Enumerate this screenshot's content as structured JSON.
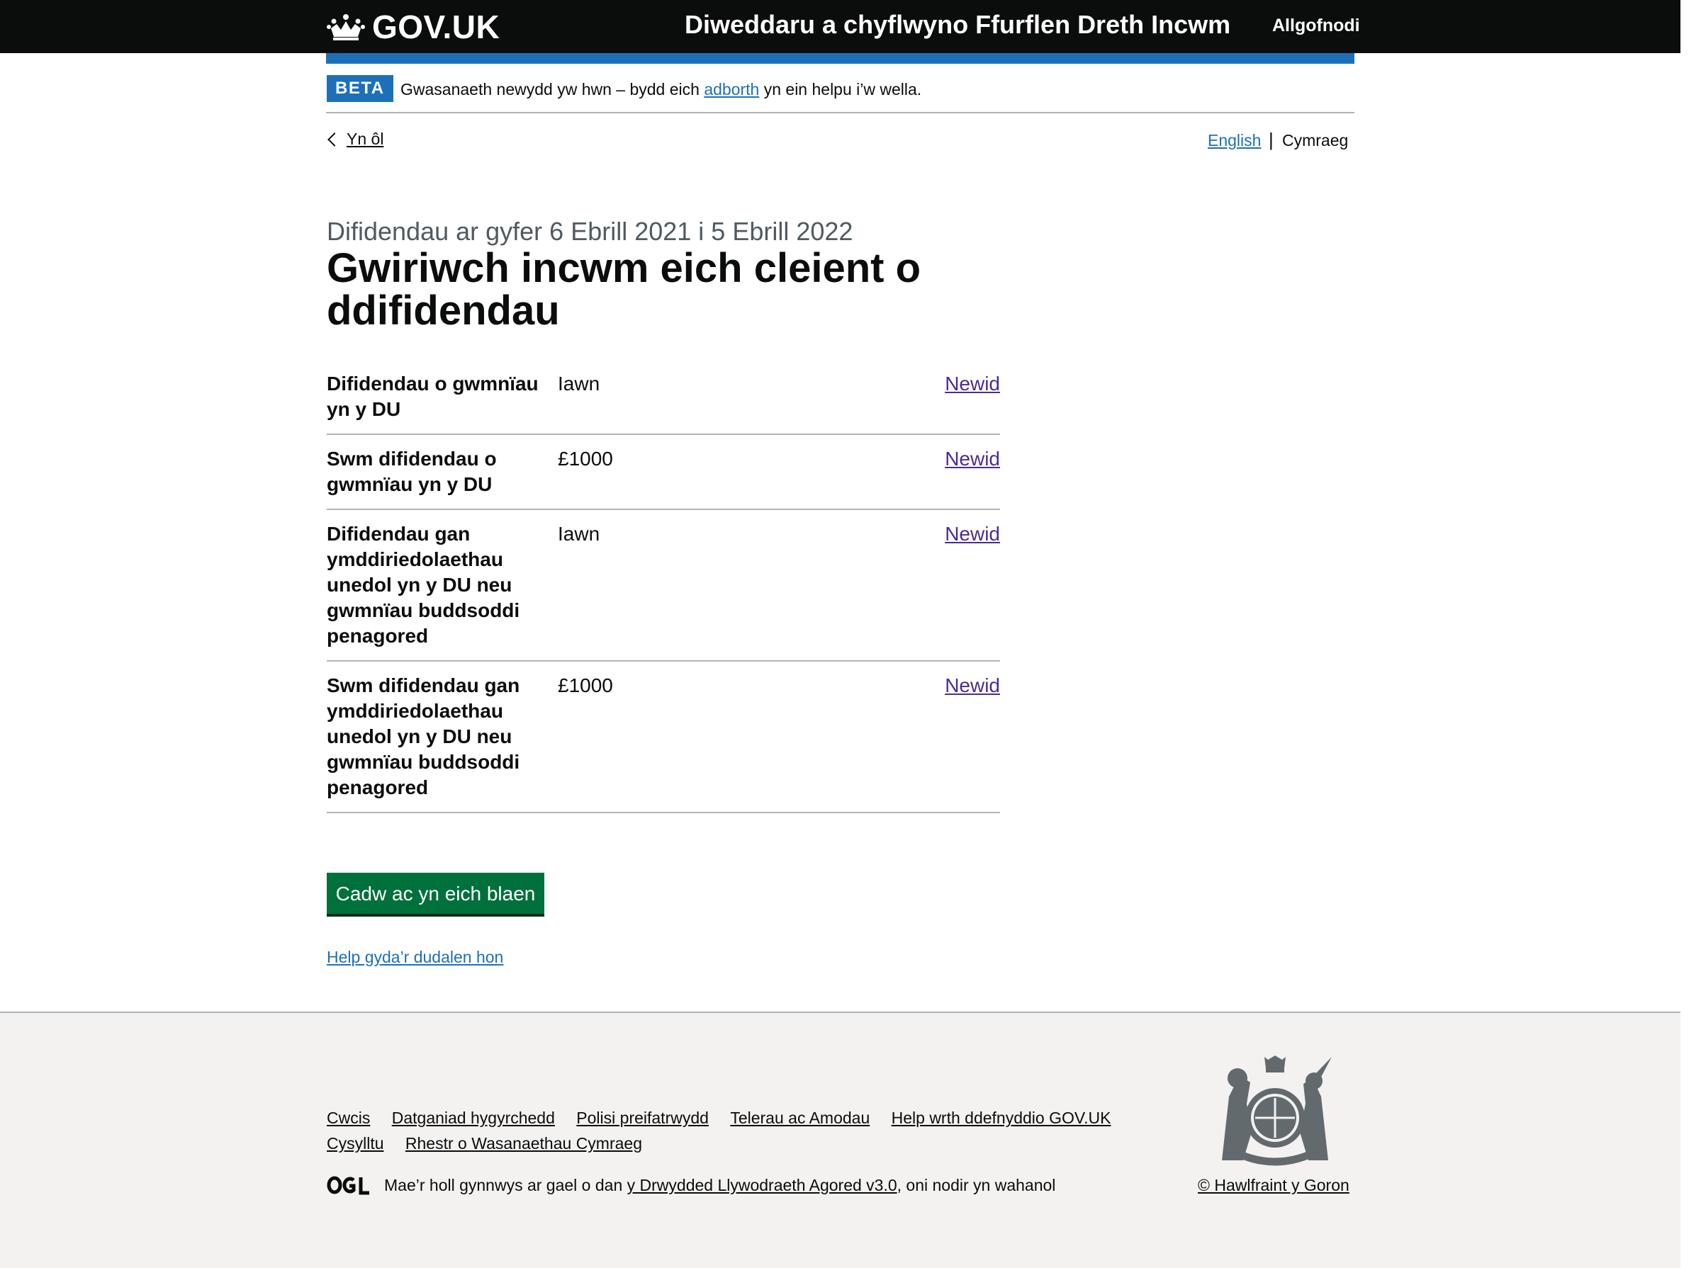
{
  "header": {
    "logo_text": "GOV.UK",
    "service_name": "Diweddaru a chyflwyno Ffurflen Dreth Incwm",
    "signout_label": "Allgofnodi"
  },
  "phase_banner": {
    "tag": "BETA",
    "text_before": "Gwasanaeth newydd yw hwn – bydd eich ",
    "link_text": "adborth",
    "text_after": " yn ein helpu i’w wella."
  },
  "nav": {
    "back_label": "Yn ôl",
    "lang_english": "English",
    "lang_separator": "|",
    "lang_welsh": "Cymraeg"
  },
  "heading": {
    "caption": "Difidendau ar gyfer 6 Ebrill 2021 i 5 Ebrill 2022",
    "title": "Gwiriwch incwm eich cleient o ddifidendau"
  },
  "summary": [
    {
      "key": "Difidendau o gwmnïau yn y DU",
      "value": "Iawn",
      "action": "Newid"
    },
    {
      "key": "Swm difidendau o gwmnïau yn y DU",
      "value": "£1000",
      "action": "Newid"
    },
    {
      "key": "Difidendau gan ymddiriedolaethau unedol yn y DU neu gwmnïau buddsoddi penagored",
      "value": "Iawn",
      "action": "Newid"
    },
    {
      "key": "Swm difidendau gan ymddiriedolaethau unedol yn y DU neu gwmnïau buddsoddi penagored",
      "value": "£1000",
      "action": "Newid"
    }
  ],
  "actions": {
    "continue_label": "Cadw ac yn eich blaen",
    "help_link": "Help gyda’r dudalen hon"
  },
  "footer": {
    "links": [
      "Cwcis",
      "Datganiad hygyrchedd",
      "Polisi preifatrwydd",
      "Telerau ac Amodau",
      "Help wrth ddefnyddio GOV.UK",
      "Cysylltu",
      "Rhestr o Wasanaethau Cymraeg"
    ],
    "ogl_text_before": "Mae’r holl gynnwys ar gael o dan ",
    "ogl_link": "y Drwydded Llywodraeth Agored v3.0",
    "ogl_text_after": ", oni nodir yn wahanol",
    "copyright": "© Hawlfraint y Goron"
  },
  "colors": {
    "header_bg": "#0b0c0c",
    "brand_blue": "#1d70b8",
    "button_green": "#00703c",
    "visited_link": "#4c2c92",
    "footer_bg": "#f3f2f1"
  }
}
